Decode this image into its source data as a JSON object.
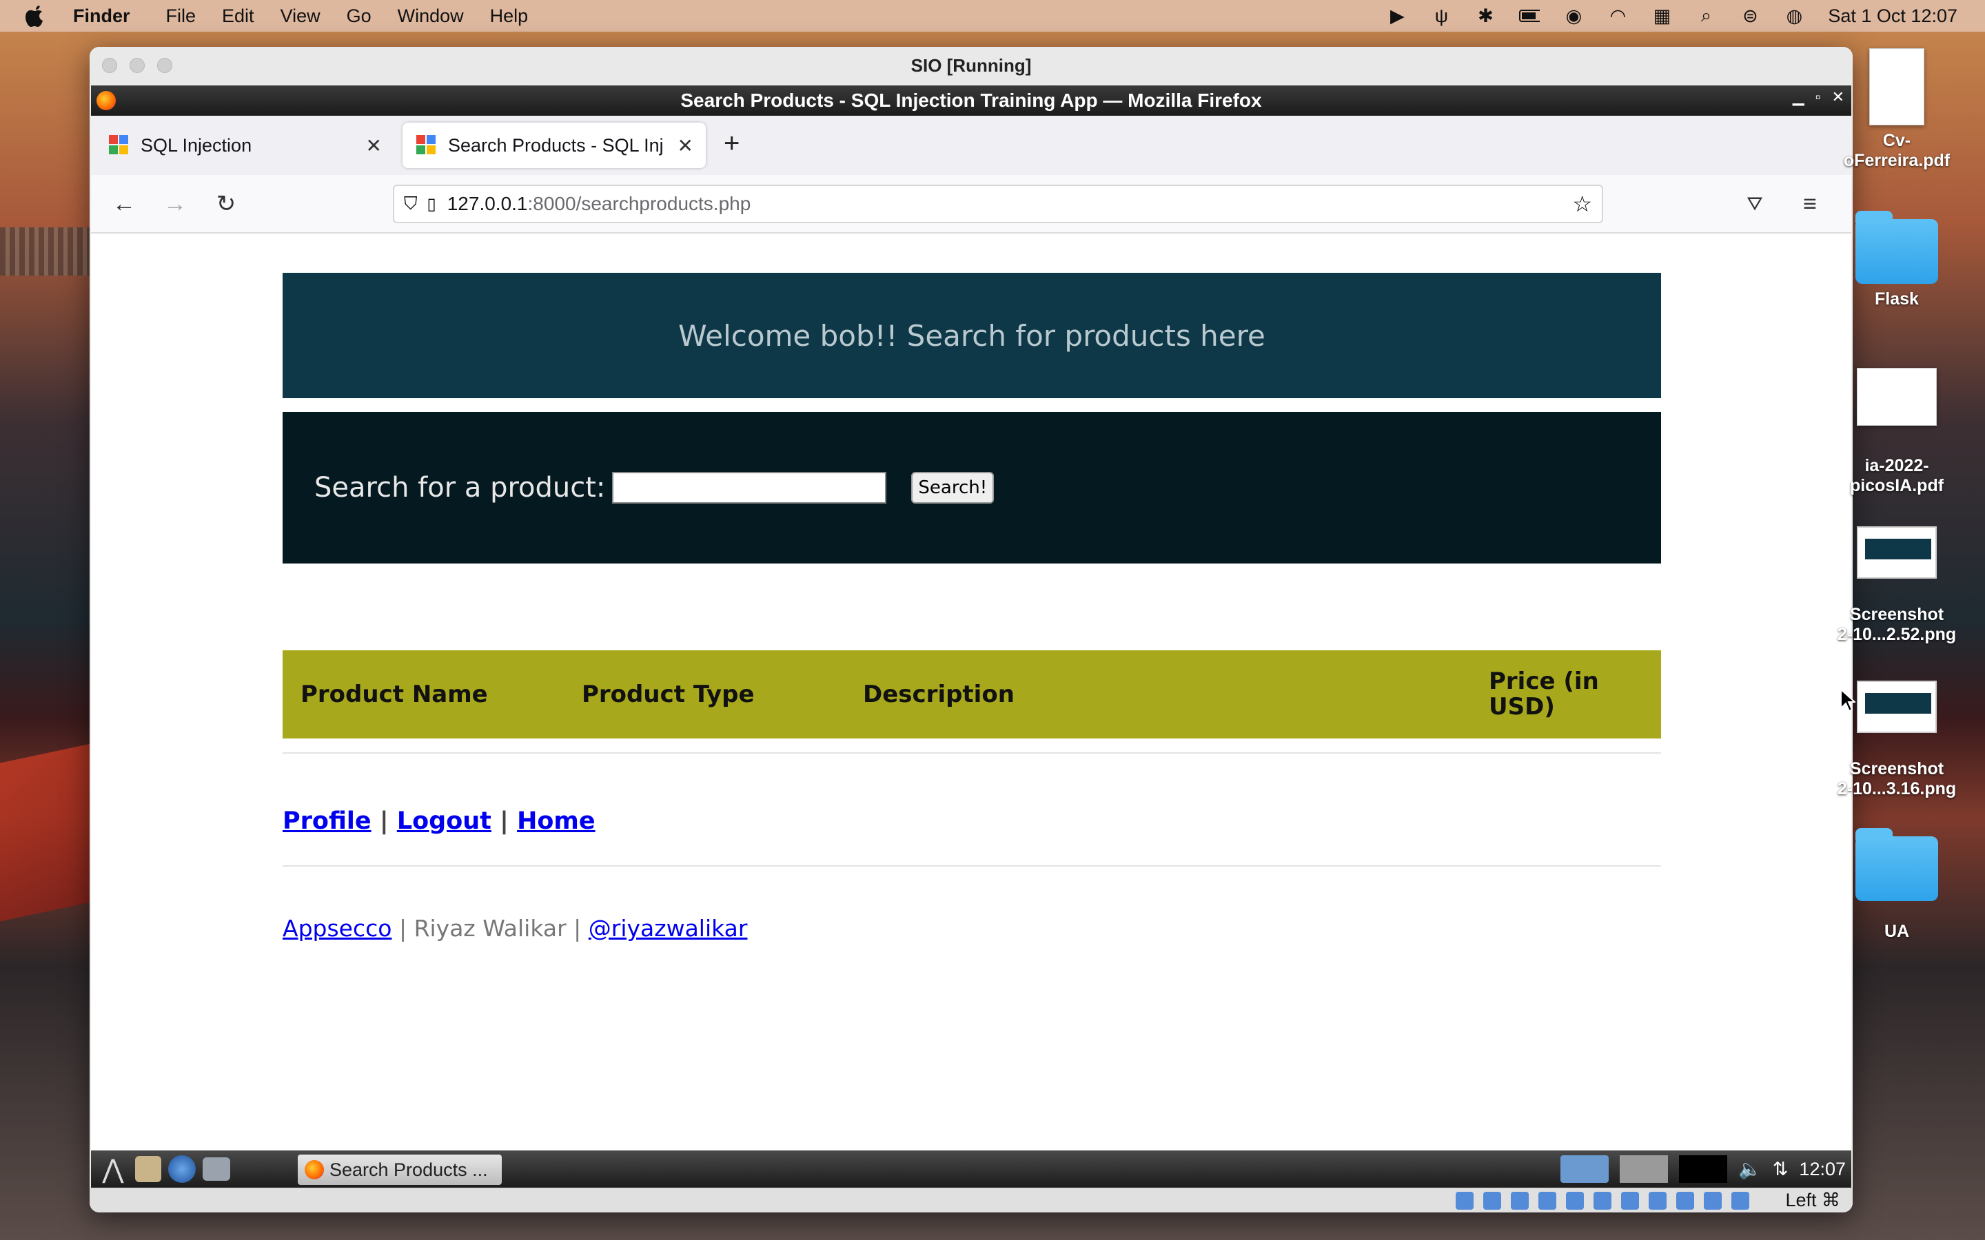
{
  "menubar": {
    "app": "Finder",
    "items": [
      "File",
      "Edit",
      "View",
      "Go",
      "Window",
      "Help"
    ],
    "clock": "Sat 1 Oct  12:07"
  },
  "vbox": {
    "title": "SIO [Running]"
  },
  "firefox": {
    "window_title": "Search Products - SQL Injection Training App — Mozilla Firefox",
    "tabs": [
      {
        "label": "SQL Injection"
      },
      {
        "label": "Search Products - SQL Inj"
      }
    ],
    "url_host": "127.0.0.1",
    "url_rest": ":8000/searchproducts.php"
  },
  "page": {
    "banner": "Welcome bob!! Search for products here",
    "search_label": "Search for a product:",
    "search_value": "",
    "search_button": "Search!",
    "table_headers": [
      "Product Name",
      "Product Type",
      "Description",
      "Price (in USD)"
    ],
    "links": [
      "Profile",
      "Logout",
      "Home"
    ],
    "link_sep": "|",
    "footer": {
      "company": "Appsecco",
      "author": "Riyaz Walikar",
      "handle": "@riyazwalikar",
      "sep": "|"
    }
  },
  "taskbar": {
    "task_label": "Search Products ...",
    "clock": "12:07"
  },
  "statusbar": {
    "host_key": "Left ⌘"
  },
  "desktop": {
    "icons": [
      {
        "label1": "Cv-",
        "label2": "oFerreira.pdf",
        "kind": "doc"
      },
      {
        "label1": "Flask",
        "label2": "",
        "kind": "folder"
      },
      {
        "label1": "ia-2022-",
        "label2": "picosIA.pdf",
        "kind": "doc"
      },
      {
        "label1": "Screenshot",
        "label2": "2-10...2.52.png",
        "kind": "image"
      },
      {
        "label1": "Screenshot",
        "label2": "2-10...3.16.png",
        "kind": "image"
      },
      {
        "label1": "UA",
        "label2": "",
        "kind": "folder"
      }
    ]
  },
  "colors": {
    "banner_bg": "#0e3847",
    "search_bg": "#041920",
    "table_header_bg": "#a8a81c",
    "link": "#0000ee"
  }
}
